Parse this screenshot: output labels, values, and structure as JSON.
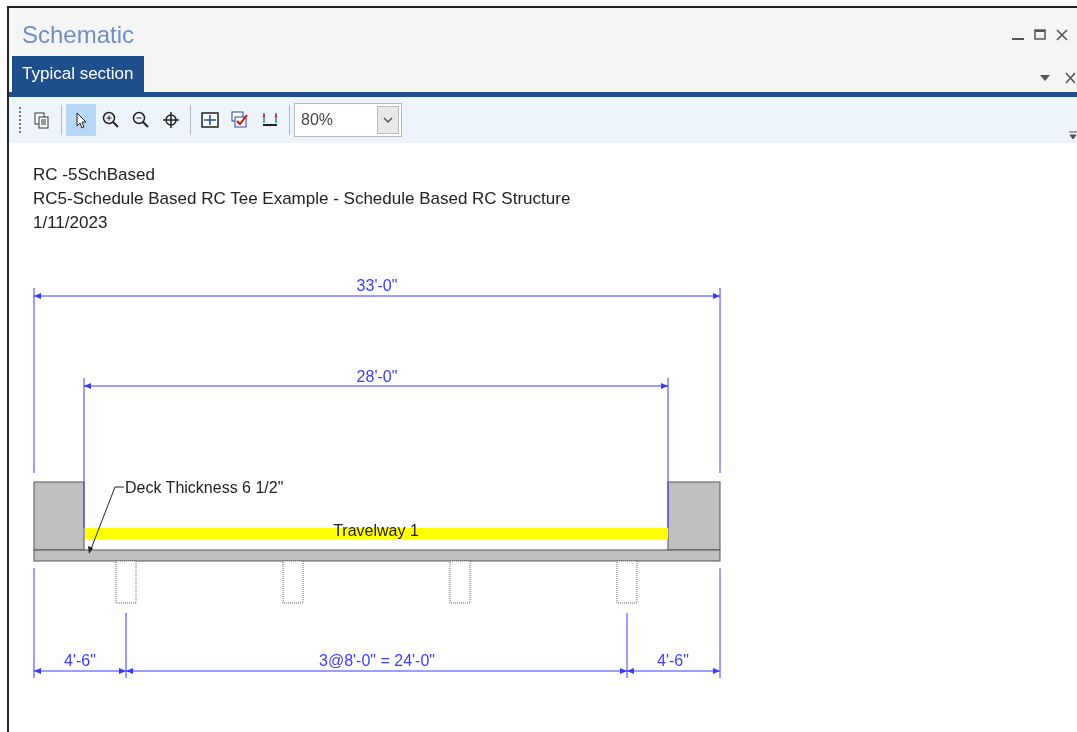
{
  "window": {
    "title": "Schematic"
  },
  "tabs": [
    {
      "label": "Typical section",
      "selected": true
    }
  ],
  "toolbar": {
    "tools": [
      {
        "kind": "copy",
        "selected": false
      },
      {
        "kind": "select",
        "selected": true
      },
      {
        "kind": "zoom-in",
        "selected": false
      },
      {
        "kind": "zoom-out",
        "selected": false
      },
      {
        "kind": "pan",
        "selected": false
      },
      {
        "kind": "fit",
        "selected": false
      },
      {
        "kind": "check",
        "selected": false
      },
      {
        "kind": "dimension",
        "selected": false
      }
    ],
    "zoom": {
      "value": "80%"
    }
  },
  "header": [
    "RC -5SchBased",
    "RC5-Schedule Based RC Tee Example - Schedule Based RC Structure",
    "1/11/2023"
  ],
  "drawing": {
    "overall_width": "33'-0\"",
    "travelway_width": "28'-0\"",
    "deck_label": "Deck Thickness 6 1/2\"",
    "travelway_label": "Travelway 1",
    "bottom_dims": [
      "4'-6\"",
      "3@8'-0\" = 24'-0\"",
      "4'-6\""
    ]
  }
}
